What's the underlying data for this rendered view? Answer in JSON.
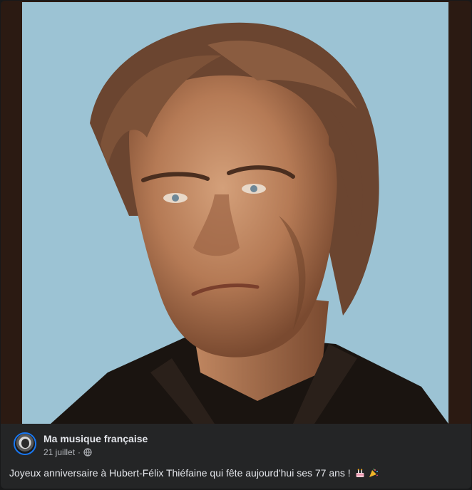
{
  "post": {
    "page_name": "Ma musique française",
    "date": "21 juillet",
    "separator": "·",
    "audience_icon": "globe-icon",
    "caption": "Joyeux anniversaire à Hubert-Félix Thiéfaine qui fête aujourd'hui ses 77 ans !",
    "emojis": [
      "birthday-cake-icon",
      "party-popper-icon"
    ],
    "photo_subject": "portrait photo of a man with tousled hair against a light blue background"
  },
  "colors": {
    "card_bg": "#242526",
    "photo_bg": "#9cc3d4",
    "text_primary": "#e4e6eb",
    "text_secondary": "#b0b3b8",
    "avatar_ring": "#1877f2"
  }
}
